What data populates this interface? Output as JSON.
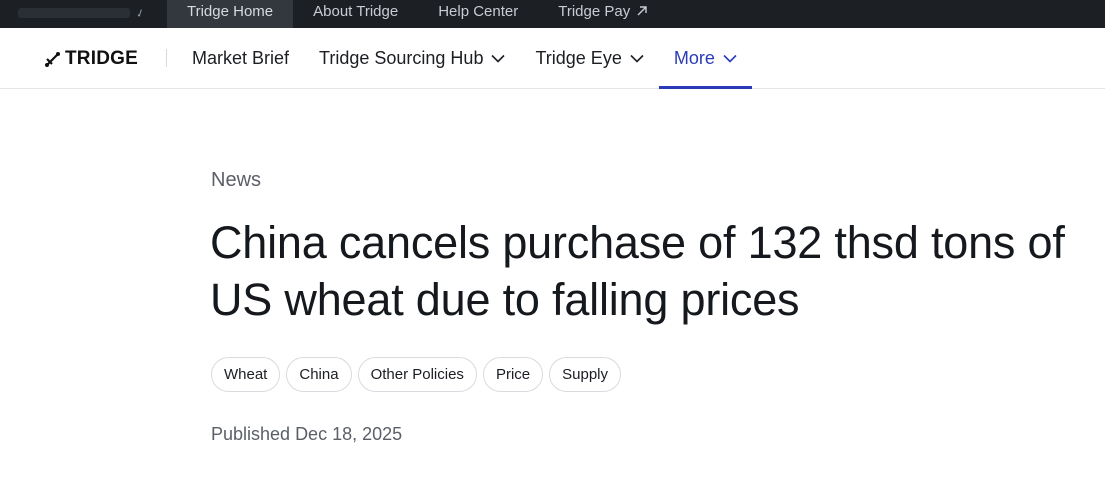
{
  "topbar": {
    "tabs": [
      {
        "label": "Tridge Home",
        "active": true
      },
      {
        "label": "About Tridge",
        "active": false
      },
      {
        "label": "Help Center",
        "active": false
      },
      {
        "label": "Tridge Pay",
        "active": false,
        "icon": "external-link-icon"
      }
    ]
  },
  "nav": {
    "logo_text": "TRIDGE",
    "logo_icon": "tridge-logo-icon",
    "items": [
      {
        "label": "Market Brief",
        "dropdown": false
      },
      {
        "label": "Tridge Sourcing Hub",
        "dropdown": true
      },
      {
        "label": "Tridge Eye",
        "dropdown": true
      },
      {
        "label": "More",
        "dropdown": true,
        "active": true
      }
    ],
    "accent_color": "#2b3bb8"
  },
  "article": {
    "category": "News",
    "title": "China cancels purchase of 132 thsd tons of US wheat due to falling prices",
    "tags": [
      "Wheat",
      "China",
      "Other Policies",
      "Price",
      "Supply"
    ],
    "published_label": "Published",
    "published_date": "Dec 18, 2025"
  }
}
